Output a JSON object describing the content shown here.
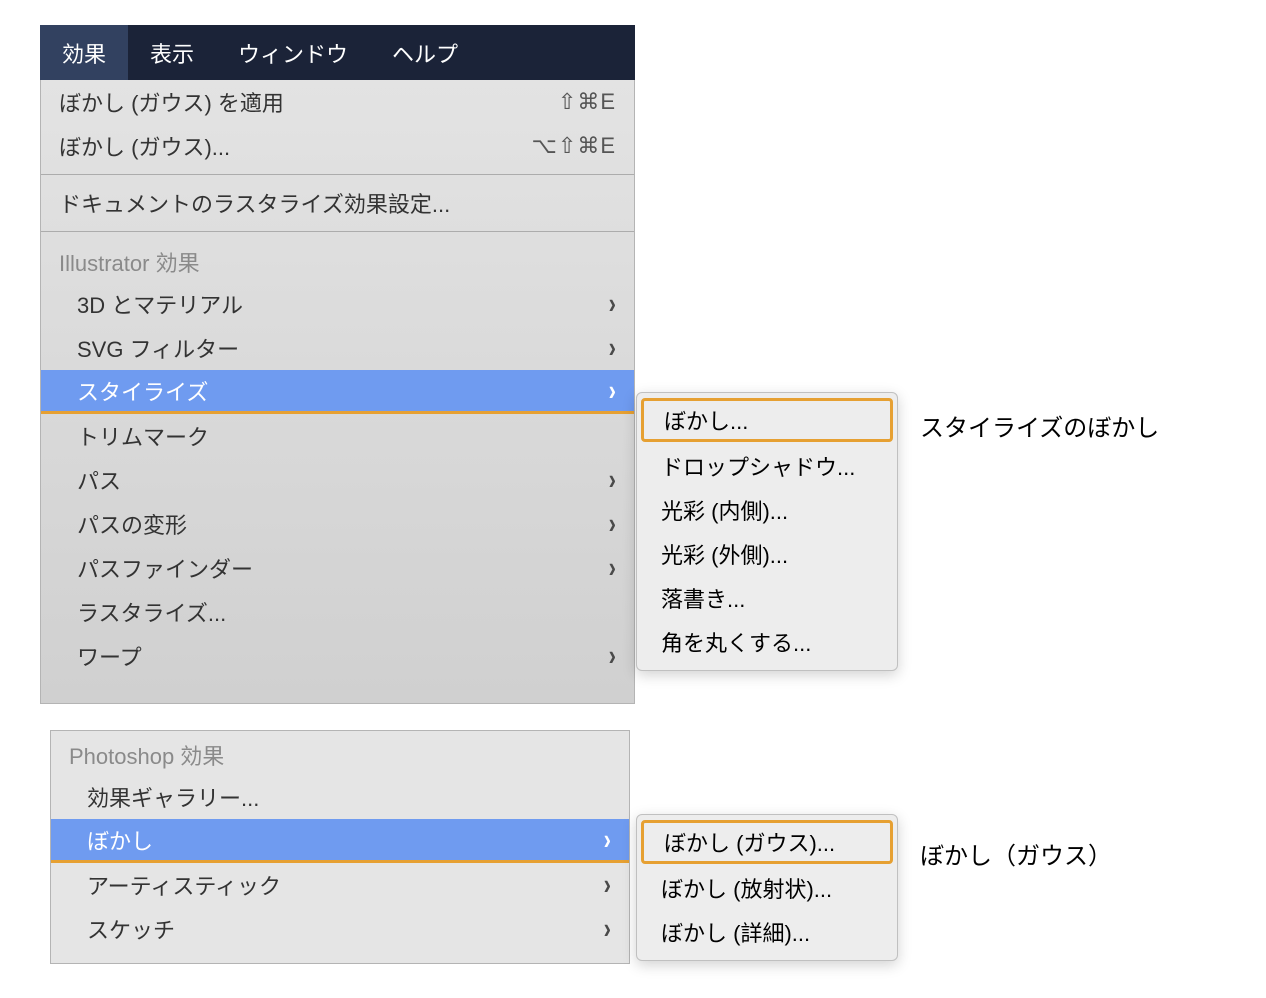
{
  "menubar": {
    "items": [
      {
        "label": "効果",
        "active": true
      },
      {
        "label": "表示"
      },
      {
        "label": "ウィンドウ"
      },
      {
        "label": "ヘルプ"
      }
    ]
  },
  "dropdown_top": {
    "header1": {
      "label": "ぼかし (ガウス) を適用",
      "shortcut": "⇧⌘E"
    },
    "header2": {
      "label": "ぼかし (ガウス)...",
      "shortcut": "⌥⇧⌘E"
    },
    "raster": {
      "label": "ドキュメントのラスタライズ効果設定..."
    },
    "section_illustrator": "Illustrator 効果",
    "items": [
      {
        "label": "3D とマテリアル",
        "arrow": true
      },
      {
        "label": "SVG フィルター",
        "arrow": true
      },
      {
        "label": "スタイライズ",
        "arrow": true,
        "highlight": true
      },
      {
        "label": "トリムマーク"
      },
      {
        "label": "パス",
        "arrow": true
      },
      {
        "label": "パスの変形",
        "arrow": true
      },
      {
        "label": "パスファインダー",
        "arrow": true
      },
      {
        "label": "ラスタライズ..."
      },
      {
        "label": "ワープ",
        "arrow": true
      }
    ]
  },
  "submenu_top": {
    "items": [
      {
        "label": "ぼかし...",
        "boxed": true
      },
      {
        "label": "ドロップシャドウ..."
      },
      {
        "label": "光彩 (内側)..."
      },
      {
        "label": "光彩 (外側)..."
      },
      {
        "label": "落書き..."
      },
      {
        "label": "角を丸くする..."
      }
    ]
  },
  "dropdown_bottom": {
    "section_photoshop": "Photoshop 効果",
    "items": [
      {
        "label": "効果ギャラリー..."
      },
      {
        "label": "ぼかし",
        "arrow": true,
        "highlight": true
      },
      {
        "label": "アーティスティック",
        "arrow": true
      },
      {
        "label": "スケッチ",
        "arrow": true
      }
    ]
  },
  "submenu_bottom": {
    "items": [
      {
        "label": "ぼかし (ガウス)...",
        "boxed": true
      },
      {
        "label": "ぼかし (放射状)..."
      },
      {
        "label": "ぼかし (詳細)..."
      }
    ]
  },
  "annotations": {
    "a1": "スタイライズのぼかし",
    "a2": "ぼかし（ガウス）"
  }
}
